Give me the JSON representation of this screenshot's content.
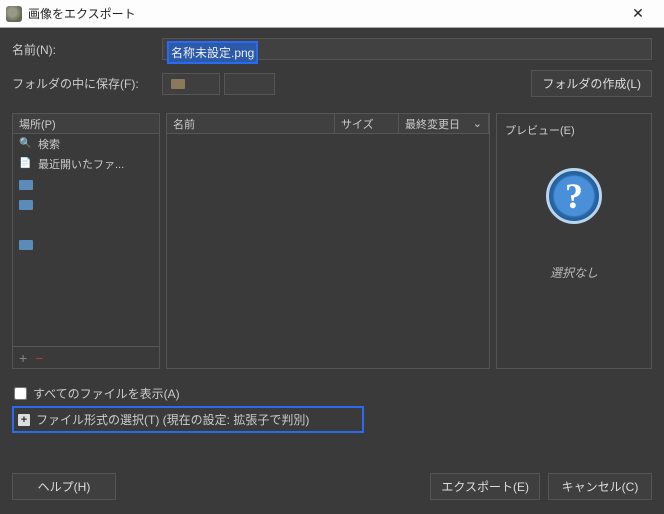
{
  "window": {
    "title": "画像をエクスポート"
  },
  "name": {
    "label": "名前(N):",
    "value": "名称未設定.png"
  },
  "folder": {
    "label": "フォルダの中に保存(F):",
    "create_label": "フォルダの作成(L)"
  },
  "places": {
    "header": "場所(P)",
    "items": [
      {
        "icon": "search",
        "label": "検索"
      },
      {
        "icon": "recent",
        "label": "最近開いたファ..."
      },
      {
        "icon": "folder",
        "label": ""
      },
      {
        "icon": "folder",
        "label": ""
      },
      {
        "icon": "none",
        "label": ""
      },
      {
        "icon": "folder",
        "label": ""
      },
      {
        "icon": "none",
        "label": ""
      }
    ]
  },
  "filelist": {
    "col_name": "名前",
    "col_size": "サイズ",
    "col_date": "最終変更日"
  },
  "preview": {
    "header": "プレビュー(E)",
    "placeholder": "選択なし"
  },
  "show_all": {
    "label": "すべてのファイルを表示(A)"
  },
  "filetype": {
    "label": "ファイル形式の選択(T) (現在の設定: 拡張子で判別)"
  },
  "buttons": {
    "help": "ヘルプ(H)",
    "export": "エクスポート(E)",
    "cancel": "キャンセル(C)"
  }
}
